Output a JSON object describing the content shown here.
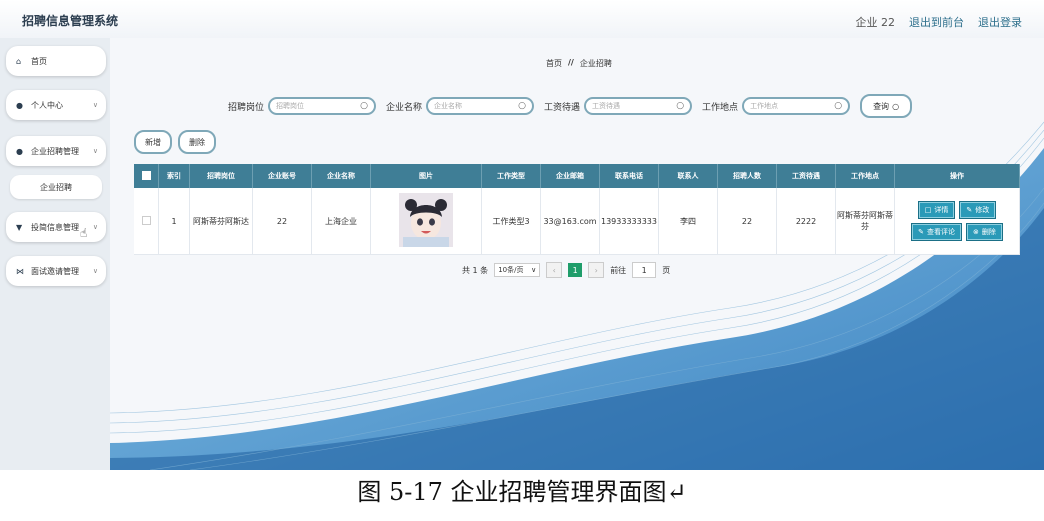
{
  "header": {
    "title": "招聘信息管理系统",
    "user": "企业 22",
    "to_front": "退出到前台",
    "logout": "退出登录"
  },
  "sidebar": {
    "items": [
      {
        "label": "首页",
        "icon": "home-icon"
      },
      {
        "label": "个人中心",
        "icon": "person-icon"
      },
      {
        "label": "企业招聘管理",
        "icon": "person-icon"
      },
      {
        "label": "投简信息管理",
        "icon": "pin-icon"
      },
      {
        "label": "面试邀请管理",
        "icon": "bowtie-icon"
      }
    ],
    "sub_item": "企业招聘"
  },
  "breadcrumb": {
    "home": "首页",
    "sep": "//",
    "current": "企业招聘"
  },
  "search": {
    "fields": [
      {
        "label": "招聘岗位",
        "placeholder": "招聘岗位"
      },
      {
        "label": "企业名称",
        "placeholder": "企业名称"
      },
      {
        "label": "工资待遇",
        "placeholder": "工资待遇"
      },
      {
        "label": "工作地点",
        "placeholder": "工作地点"
      }
    ],
    "query": "查询"
  },
  "actions": {
    "add": "新增",
    "delete": "删除"
  },
  "table": {
    "columns": [
      "索引",
      "招聘岗位",
      "企业账号",
      "企业名称",
      "图片",
      "工作类型",
      "企业邮箱",
      "联系电话",
      "联系人",
      "招聘人数",
      "工资待遇",
      "工作地点",
      "操作"
    ],
    "row": {
      "index": "1",
      "position": "阿斯蒂芬阿斯达",
      "account": "22",
      "company": "上海企业",
      "type": "工作类型3",
      "email": "33@163.com",
      "phone": "13933333333",
      "contact": "李四",
      "count": "22",
      "salary": "2222",
      "location": "阿斯蒂芬阿斯蒂芬"
    },
    "ops": {
      "detail": "详情",
      "edit": "修改",
      "comment": "查看评论",
      "delete": "删除"
    }
  },
  "pager": {
    "total": "共 1 条",
    "size": "10条/页",
    "current": "1",
    "goto": "前往",
    "goto_value": "1",
    "page_unit": "页"
  },
  "caption": "图 5-17 企业招聘管理界面图↵",
  "colors": {
    "table_header": "#3f7e96",
    "op_button": "#2a9ab8",
    "page_active": "#1f9d6a"
  }
}
